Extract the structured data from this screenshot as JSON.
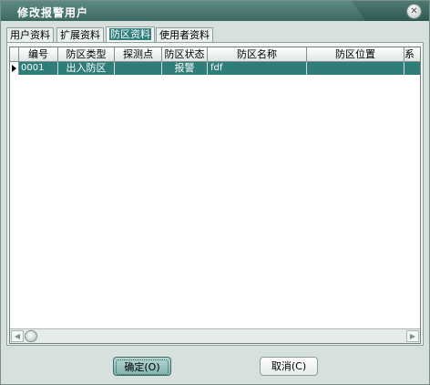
{
  "window": {
    "title": "修改报警用户",
    "close_glyph": "✕"
  },
  "tabs": [
    {
      "label": "用户资料",
      "active": false
    },
    {
      "label": "扩展资料",
      "active": false
    },
    {
      "label": "防区资料",
      "active": true
    },
    {
      "label": "使用者资料",
      "active": false
    }
  ],
  "grid": {
    "columns": [
      "编号",
      "防区类型",
      "探测点",
      "防区状态",
      "防区名称",
      "防区位置",
      "系"
    ],
    "rows": [
      {
        "id": "0001",
        "type": "出入防区",
        "probe": "",
        "status": "报警",
        "name": "fdf",
        "location": "",
        "sys": ""
      }
    ],
    "selected_color": "#2f7d79"
  },
  "buttons": {
    "ok": "确定(O)",
    "cancel": "取消(C)"
  }
}
